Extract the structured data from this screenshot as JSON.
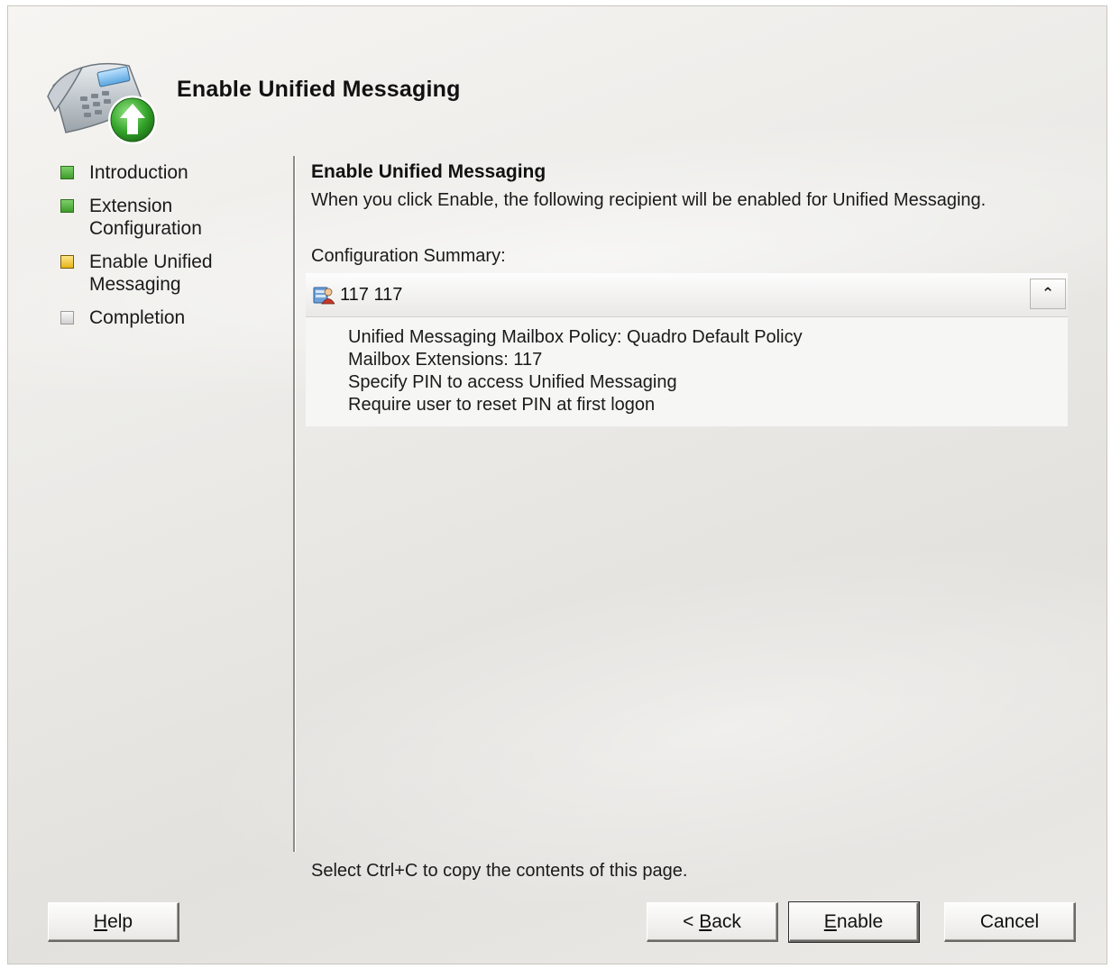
{
  "window": {
    "title": "Enable Unified Messaging"
  },
  "nav": {
    "items": [
      {
        "label": "Introduction",
        "state": "done"
      },
      {
        "label": "Extension\nConfiguration",
        "state": "done"
      },
      {
        "label": "Enable Unified\nMessaging",
        "state": "current"
      },
      {
        "label": "Completion",
        "state": "pending"
      }
    ]
  },
  "main": {
    "title": "Enable Unified Messaging",
    "description": "When you click Enable, the following recipient will be enabled for Unified Messaging.",
    "summary_label": "Configuration Summary:",
    "summary": {
      "recipient": "117 117",
      "collapse_icon": "double-chevron-up-icon",
      "lines": [
        "Unified Messaging Mailbox Policy: Quadro Default Policy",
        "Mailbox Extensions: 117",
        "Specify PIN to access Unified Messaging",
        "Require user to reset PIN at first logon"
      ]
    },
    "copy_hint": "Select Ctrl+C to copy the contents of this page."
  },
  "buttons": {
    "help": {
      "mnemonic": "H",
      "rest": "elp"
    },
    "back": {
      "prefix": "< ",
      "mnemonic": "B",
      "rest": "ack"
    },
    "enable": {
      "mnemonic": "E",
      "rest": "nable"
    },
    "cancel": {
      "label": "Cancel"
    }
  },
  "colors": {
    "step_done": "#3e9c2a",
    "step_current": "#e6b417",
    "step_pending": "#d0d0d0",
    "header_arrow": "#2e9b2a"
  }
}
